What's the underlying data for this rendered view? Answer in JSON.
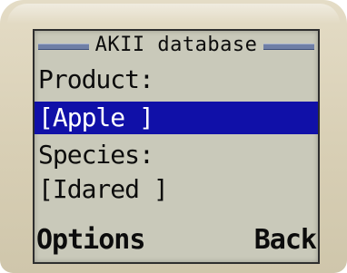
{
  "screen": {
    "title": "AKII database",
    "product_label": "Product:",
    "product_value": "[Apple ]",
    "species_label": "Species:",
    "species_value": "[Idared ]"
  },
  "softkeys": {
    "left": "Options",
    "right": "Back"
  },
  "colors": {
    "selection": "#1010a8",
    "screen_bg": "#c9c9ba",
    "title_rule": "#6f7fa6",
    "bezel": "#d9d0b6"
  }
}
